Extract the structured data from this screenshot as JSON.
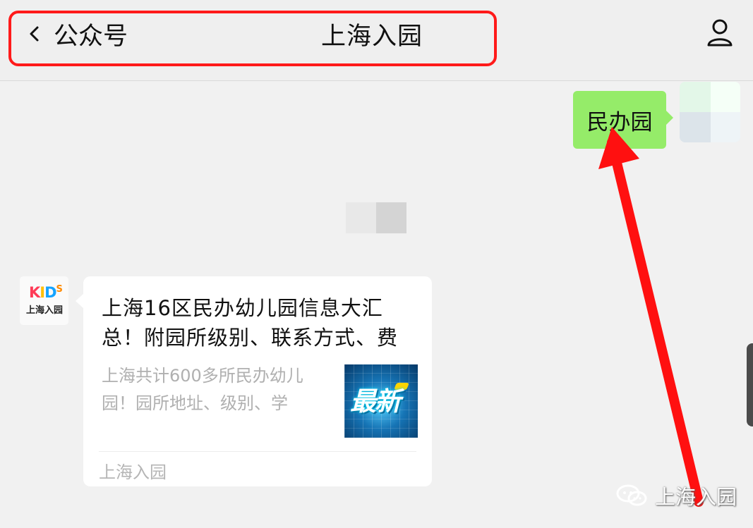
{
  "header": {
    "back_label": "公众号",
    "title": "上海入园"
  },
  "messages": {
    "sent_text": "民办园",
    "article": {
      "title": "上海16区民办幼儿园信息大汇总！附园所级别、联系方式、费",
      "description": "上海共计600多所民办幼儿园！园所地址、级别、学",
      "thumbnail_text": "最新",
      "source": "上海入园"
    }
  },
  "account_avatar": {
    "brand": "KIDS",
    "label": "上海入园"
  },
  "watermark": {
    "text": "上海入园"
  },
  "colors": {
    "highlight": "#ff1a1a",
    "sent_bubble": "#95ec69"
  },
  "icons": {
    "back": "chevron-left-icon",
    "profile": "person-icon",
    "wechat": "wechat-icon"
  }
}
